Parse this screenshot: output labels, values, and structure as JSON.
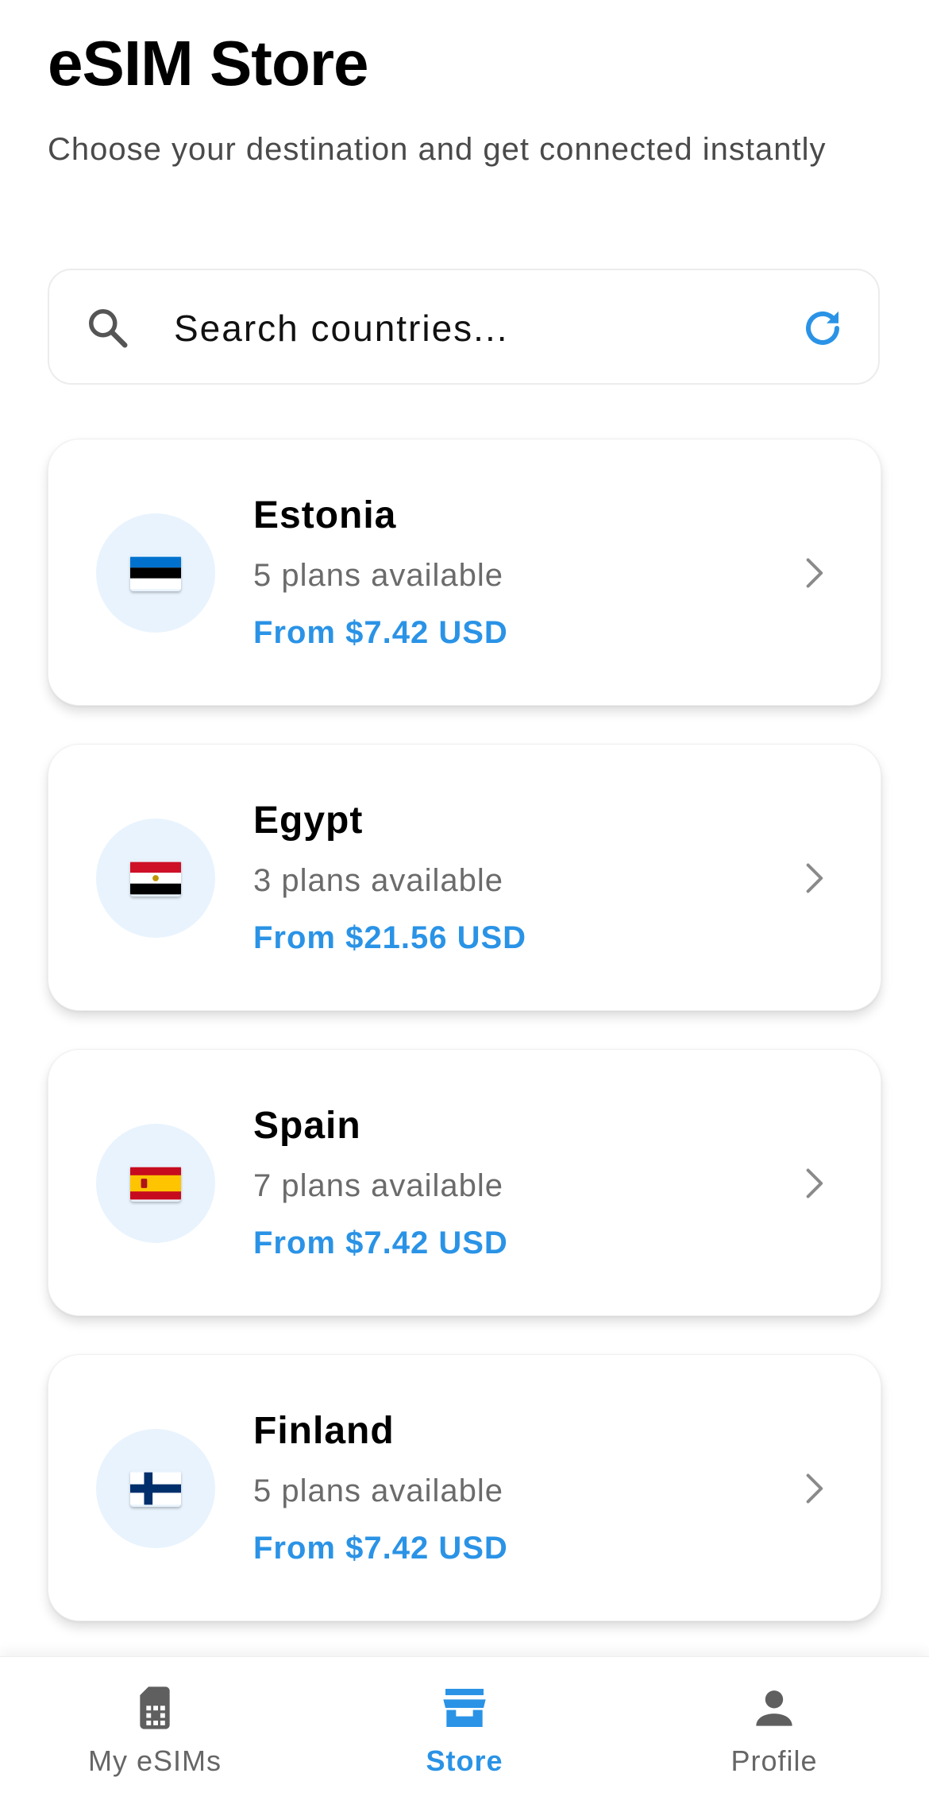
{
  "header": {
    "title": "eSIM Store",
    "subtitle": "Choose your destination and get connected instantly"
  },
  "search": {
    "placeholder": "Search countries...",
    "value": ""
  },
  "colors": {
    "accent": "#2a93e6",
    "flag_circle_bg": "#e8f3fd",
    "muted_text": "#6b6b6b"
  },
  "countries": [
    {
      "name": "Estonia",
      "plans": "5 plans available",
      "price": "From $7.42 USD",
      "flag_icon": "estonia-flag"
    },
    {
      "name": "Egypt",
      "plans": "3 plans available",
      "price": "From $21.56 USD",
      "flag_icon": "egypt-flag"
    },
    {
      "name": "Spain",
      "plans": "7 plans available",
      "price": "From $7.42 USD",
      "flag_icon": "spain-flag"
    },
    {
      "name": "Finland",
      "plans": "5 plans available",
      "price": "From $7.42 USD",
      "flag_icon": "finland-flag"
    }
  ],
  "nav": {
    "items": [
      {
        "label": "My eSIMs",
        "icon": "sim-card-icon",
        "active": false
      },
      {
        "label": "Store",
        "icon": "store-icon",
        "active": true
      },
      {
        "label": "Profile",
        "icon": "person-icon",
        "active": false
      }
    ]
  }
}
